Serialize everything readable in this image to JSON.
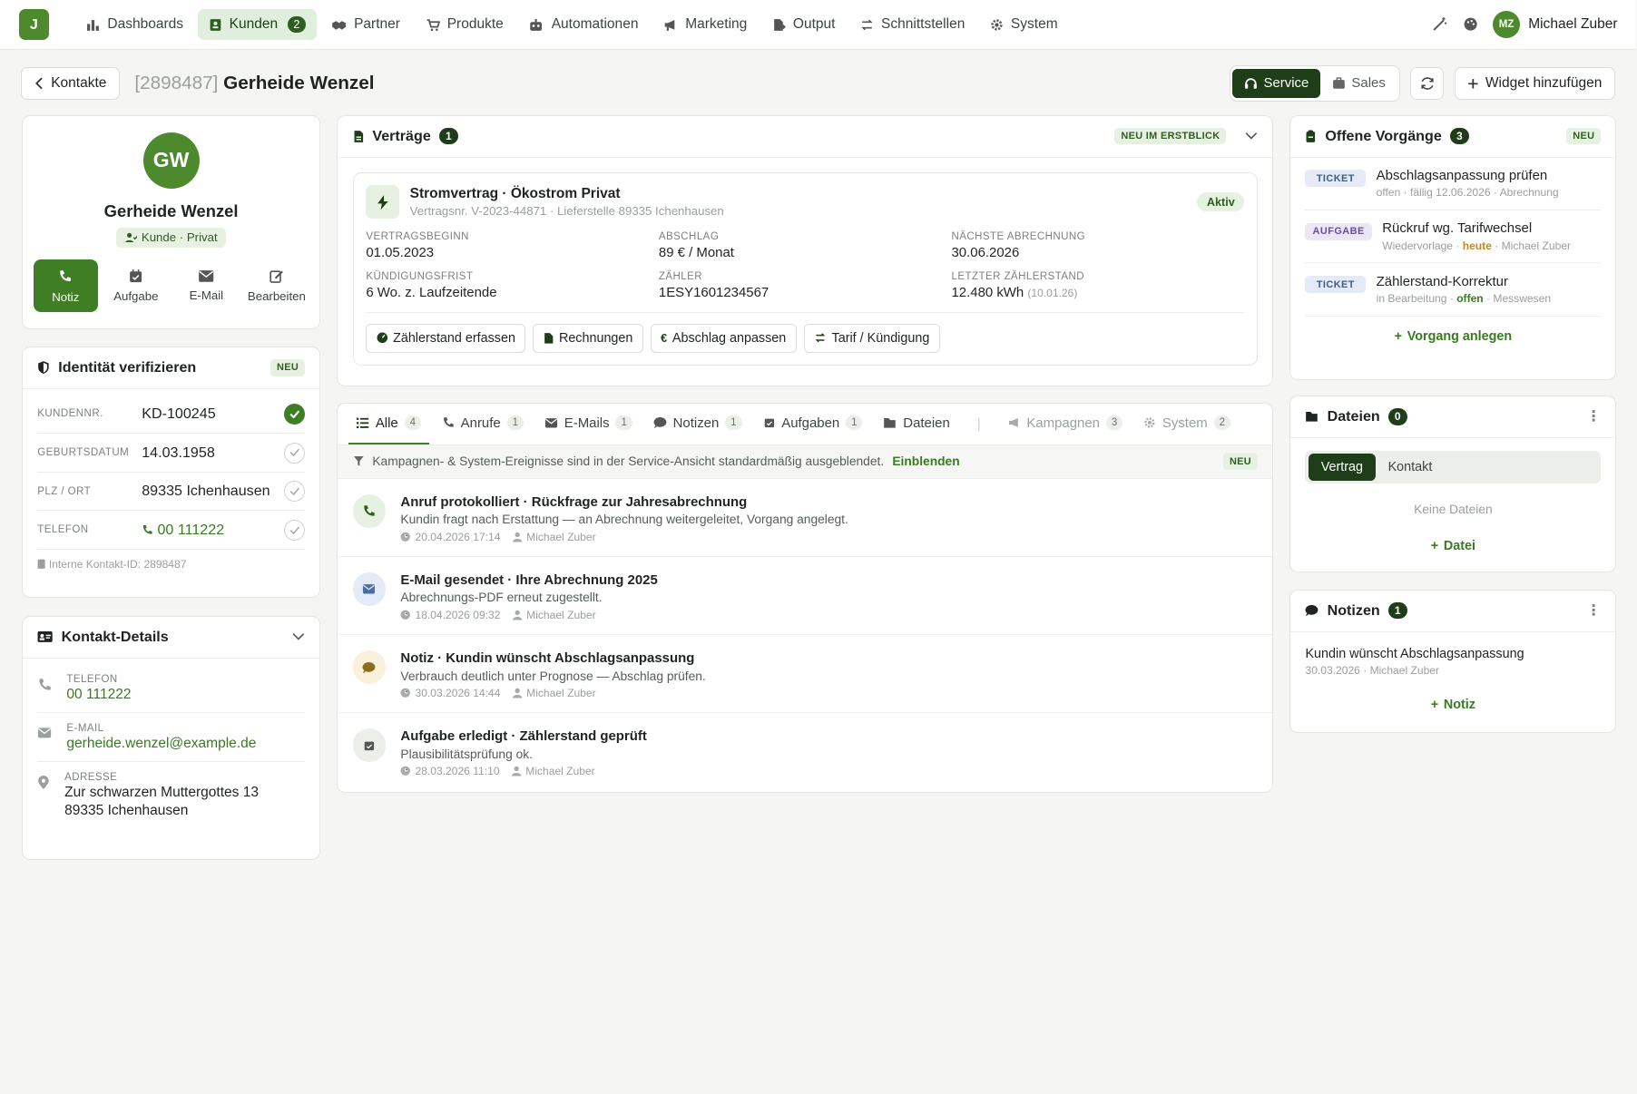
{
  "nav": {
    "logo": "J",
    "items": [
      {
        "label": "Dashboards"
      },
      {
        "label": "Kunden",
        "badge": "2"
      },
      {
        "label": "Partner"
      },
      {
        "label": "Produkte"
      },
      {
        "label": "Automationen"
      },
      {
        "label": "Marketing"
      },
      {
        "label": "Output"
      },
      {
        "label": "Schnittstellen"
      },
      {
        "label": "System"
      }
    ],
    "user": {
      "initials": "MZ",
      "name": "Michael Zuber"
    }
  },
  "header": {
    "back": "Kontakte",
    "id": "[2898487]",
    "name": "Gerheide Wenzel",
    "view_service": "Service",
    "view_sales": "Sales",
    "add_widget": "Widget hinzufügen"
  },
  "profile": {
    "initials": "GW",
    "name": "Gerheide Wenzel",
    "tag": "Kunde · Privat",
    "actions": {
      "notiz": "Notiz",
      "aufgabe": "Aufgabe",
      "email": "E-Mail",
      "bearbeiten": "Bearbeiten"
    }
  },
  "identity": {
    "title": "Identität verifizieren",
    "neu": "NEU",
    "rows": [
      {
        "label": "KUNDENNR.",
        "value": "KD-100245"
      },
      {
        "label": "GEBURTSDATUM",
        "value": "14.03.1958"
      },
      {
        "label": "PLZ / ORT",
        "value": "89335 Ichenhausen"
      },
      {
        "label": "TELEFON",
        "value": "00 111222"
      }
    ],
    "internal": "Interne Kontakt-ID: 2898487"
  },
  "details": {
    "title": "Kontakt-Details",
    "phone_label": "TELEFON",
    "phone": "00 111222",
    "email_label": "E-MAIL",
    "email": "gerheide.wenzel@example.de",
    "address_label": "ADRESSE",
    "address1": "Zur schwarzen Muttergottes 13",
    "address2": "89335 Ichenhausen"
  },
  "contracts": {
    "title": "Verträge",
    "count": "1",
    "neu": "NEU IM ERSTBLICK",
    "item": {
      "title": "Stromvertrag · Ökostrom Privat",
      "sub": "Vertragsnr. V-2023-44871 · Lieferstelle 89335 Ichenhausen",
      "status": "Aktiv",
      "fields": [
        {
          "label": "VERTRAGSBEGINN",
          "value": "01.05.2023"
        },
        {
          "label": "ABSCHLAG",
          "value": "89 € / Monat"
        },
        {
          "label": "NÄCHSTE ABRECHNUNG",
          "value": "30.06.2026"
        },
        {
          "label": "KÜNDIGUNGSFRIST",
          "value": "6 Wo. z. Laufzeitende"
        },
        {
          "label": "ZÄHLER",
          "value": "1ESY1601234567"
        },
        {
          "label": "LETZTER ZÄHLERSTAND",
          "value": "12.480 kWh",
          "extra": "(10.01.26)"
        }
      ],
      "actions": [
        "Zählerstand erfassen",
        "Rechnungen",
        "Abschlag anpassen",
        "Tarif / Kündigung"
      ]
    }
  },
  "timeline": {
    "tabs": [
      {
        "label": "Alle",
        "n": "4"
      },
      {
        "label": "Anrufe",
        "n": "1"
      },
      {
        "label": "E-Mails",
        "n": "1"
      },
      {
        "label": "Notizen",
        "n": "1"
      },
      {
        "label": "Aufgaben",
        "n": "1"
      },
      {
        "label": "Dateien"
      },
      {
        "label": "Kampagnen",
        "n": "3"
      },
      {
        "label": "System",
        "n": "2"
      }
    ],
    "filter_text": "Kampagnen- & System-Ereignisse sind in der Service-Ansicht standardmäßig ausgeblendet.",
    "filter_link": "Einblenden",
    "neu": "NEU",
    "items": [
      {
        "title": "Anruf protokolliert · Rückfrage zur Jahresabrechnung",
        "desc": "Kundin fragt nach Erstattung — an Abrechnung weitergeleitet, Vorgang angelegt.",
        "time": "20.04.2026 17:14",
        "user": "Michael Zuber"
      },
      {
        "title": "E-Mail gesendet · Ihre Abrechnung 2025",
        "desc": "Abrechnungs-PDF erneut zugestellt.",
        "time": "18.04.2026 09:32",
        "user": "Michael Zuber"
      },
      {
        "title": "Notiz · Kundin wünscht Abschlagsanpassung",
        "desc": "Verbrauch deutlich unter Prognose — Abschlag prüfen.",
        "time": "30.03.2026 14:44",
        "user": "Michael Zuber"
      },
      {
        "title": "Aufgabe erledigt · Zählerstand geprüft",
        "desc": "Plausibilitätsprüfung ok.",
        "time": "28.03.2026 11:10",
        "user": "Michael Zuber"
      }
    ]
  },
  "vorgaenge": {
    "title": "Offene Vorgänge",
    "count": "3",
    "neu": "NEU",
    "add": "Vorgang anlegen",
    "items": [
      {
        "type": "TICKET",
        "title": "Abschlagsanpassung prüfen",
        "m1": "offen · fällig 12.06.2026 · Abrechnung"
      },
      {
        "type": "AUFGABE",
        "title": "Rückruf wg. Tarifwechsel",
        "m1": "Wiedervorlage · ",
        "hl": "heute",
        "m2": " · Michael Zuber"
      },
      {
        "type": "TICKET",
        "title": "Zählerstand-Korrektur",
        "m1": "in Bearbeitung · ",
        "hl": "offen",
        "m2": " · Messwesen"
      }
    ]
  },
  "dateien": {
    "title": "Dateien",
    "count": "0",
    "tab1": "Vertrag",
    "tab2": "Kontakt",
    "empty": "Keine Dateien",
    "add": "Datei"
  },
  "notizen": {
    "title": "Notizen",
    "count": "1",
    "text": "Kundin wünscht Abschlagsanpassung",
    "meta": "30.03.2026 · Michael Zuber",
    "add": "Notiz"
  },
  "colors": {
    "primary": "#3f7e25",
    "dark": "#1f3d19",
    "soft": "#e7f1e2"
  }
}
